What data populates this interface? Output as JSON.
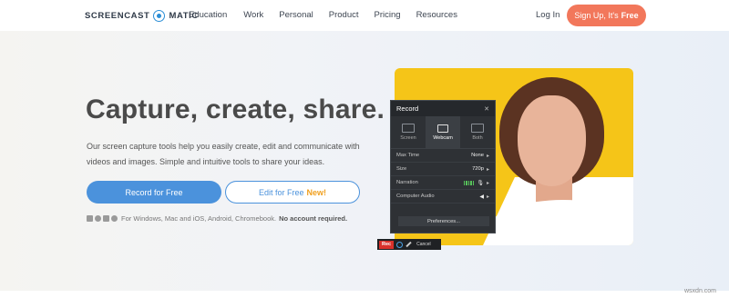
{
  "nav": {
    "logo_left": "SCREENCAST",
    "logo_right": "MATIC",
    "links": [
      "Education",
      "Work",
      "Personal",
      "Product",
      "Pricing",
      "Resources"
    ],
    "login": "Log In",
    "signup_prefix": "Sign Up, It's",
    "signup_free": "Free",
    "signup_color": "#f2775b"
  },
  "hero": {
    "headline": "Capture, create, share.",
    "subtext": "Our screen capture tools help you easily create, edit and communicate with videos and images. Simple and intuitive tools to share your ideas.",
    "primary_button": "Record for Free",
    "secondary_button": "Edit for Free",
    "secondary_badge": "New!",
    "platforms_text": "For Windows, Mac and iOS, Android, Chromebook.",
    "platforms_bold": "No account required.",
    "accent_color": "#4b92dc"
  },
  "recorder": {
    "title": "Record",
    "close": "✕",
    "modes": [
      {
        "label": "Screen",
        "active": false
      },
      {
        "label": "Webcam",
        "active": true
      },
      {
        "label": "Both",
        "active": false
      }
    ],
    "rows": [
      {
        "label": "Max Time",
        "value": "None"
      },
      {
        "label": "Size",
        "value": "720p"
      },
      {
        "label": "Narration",
        "value": ""
      },
      {
        "label": "Computer Audio",
        "value": ""
      }
    ],
    "preferences": "Preferences...",
    "toolbar": {
      "rec": "Rec",
      "cancel": "Cancel"
    }
  },
  "watermark": "wsxdn.com"
}
